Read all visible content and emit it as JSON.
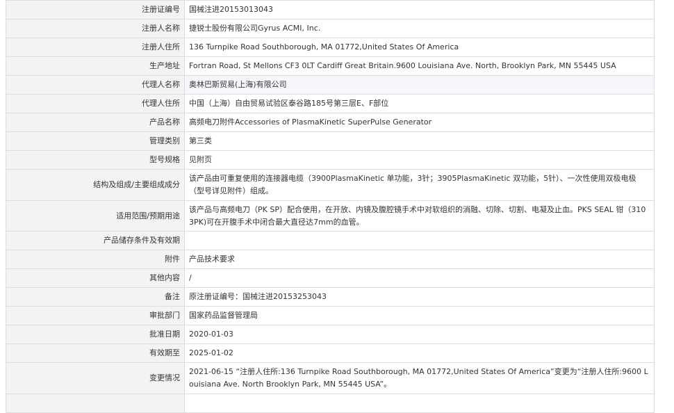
{
  "rows": [
    {
      "label": "注册证编号",
      "value": "国械注进20153013043",
      "size": "h27"
    },
    {
      "label": "注册人名称",
      "value": "捷锐士股份有限公司Gyrus ACMI, Inc.",
      "size": "h27"
    },
    {
      "label": "注册人住所",
      "value": "136 Turnpike Road Southborough, MA 01772,United States Of America",
      "size": "h27"
    },
    {
      "label": "生产地址",
      "value": "Fortran Road, St Mellons CF3 0LT Cardiff Great Britain.9600 Louisiana Ave. North, Brooklyn Park, MN 55445 USA",
      "size": "h27"
    },
    {
      "label": "代理人名称",
      "value": "奥林巴斯贸易(上海)有限公司",
      "size": "h27",
      "highlight": true
    },
    {
      "label": "代理人住所",
      "value": "中国（上海）自由贸易试验区泰谷路185号第三层E、F部位",
      "size": "h27"
    },
    {
      "label": "产品名称",
      "value": "高频电刀附件Accessories of PlasmaKinetic SuperPulse Generator",
      "size": "h27"
    },
    {
      "label": "管理类别",
      "value": "第三类",
      "size": "h27"
    },
    {
      "label": "型号规格",
      "value": "见附页",
      "size": "h27"
    },
    {
      "label": "结构及组成/主要组成成分",
      "value": "该产品由可重复使用的连接器电缆（3900PlasmaKinetic 单功能，3针；3905PlasmaKinetic 双功能，5针）、一次性使用双极电极（型号详见附件）组成。",
      "size": "h45"
    },
    {
      "label": "适用范围/预期用途",
      "value": "该产品与高频电刀（PK SP）配合使用，在开放、内镜及腹腔镜手术中对软组织的消融、切除、切割、电凝及止血。PKS SEAL 钳（3103PK)可在开腹手术中闭合最大直径达7mm的血管。",
      "size": "h44"
    },
    {
      "label": "产品储存条件及有效期",
      "value": "",
      "size": "h27"
    },
    {
      "label": "附件",
      "value": "产品技术要求",
      "size": "h27"
    },
    {
      "label": "其他内容",
      "value": "/",
      "size": "h27"
    },
    {
      "label": "备注",
      "value": "原注册证编号：国械注进20153253043",
      "size": "h27"
    },
    {
      "label": "审批部门",
      "value": "国家药品监督管理局",
      "size": "h27"
    },
    {
      "label": "批准日期",
      "value": "2020-01-03",
      "size": "h27"
    },
    {
      "label": "有效期至",
      "value": "2025-01-02",
      "size": "h27"
    },
    {
      "label": "变更情况",
      "value": "2021-06-15 “注册人住所:136 Turnpike Road Southborough, MA 01772,United States Of America”变更为“注册人住所:9600 Louisiana Ave. North Brooklyn Park, MN 55445 USA”。",
      "size": "h45"
    },
    {
      "label": "",
      "value": "",
      "size": "h27"
    }
  ]
}
